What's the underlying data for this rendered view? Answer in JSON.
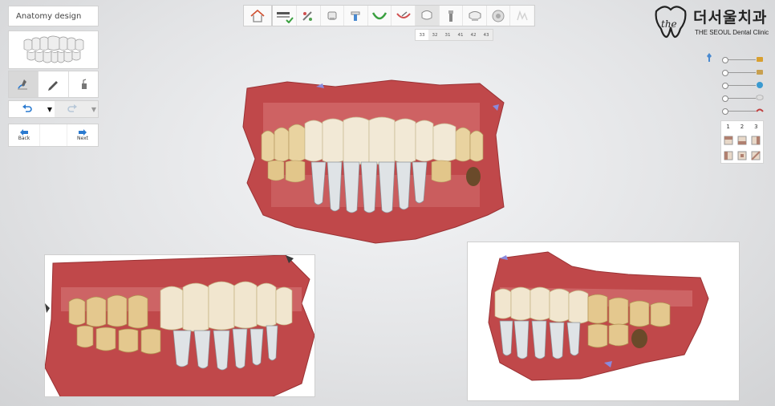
{
  "panel": {
    "title": "Anatomy design",
    "tools": [
      {
        "icon": "anatomy-tool-icon",
        "active": true
      },
      {
        "icon": "pencil-icon",
        "active": false
      },
      {
        "icon": "paint-tool-icon",
        "active": false
      }
    ],
    "nav": {
      "back_label": "Back",
      "next_label": "Next"
    }
  },
  "toolbar": {
    "steps": [
      {
        "icon": "home-icon"
      },
      {
        "icon": "scan-check-icon"
      },
      {
        "icon": "margin-icon"
      },
      {
        "icon": "model-icon"
      },
      {
        "icon": "implant-icon"
      },
      {
        "icon": "arch-icon"
      },
      {
        "icon": "cutback-icon"
      },
      {
        "icon": "tooth-icon",
        "active": true
      },
      {
        "icon": "connector-icon"
      },
      {
        "icon": "crown-icon"
      },
      {
        "icon": "mill-icon"
      },
      {
        "icon": "export-icon",
        "disabled": true
      }
    ],
    "tooth_tabs": [
      "33",
      "32",
      "31",
      "41",
      "42",
      "43"
    ]
  },
  "brand": {
    "korean_name": "더서울치과",
    "english_name": "THE SEOUL Dental Clinic"
  },
  "layers": [
    {
      "icon": "jaw-upper-icon",
      "color": "#d8a030"
    },
    {
      "icon": "jaw-lower-icon",
      "color": "#c8a050"
    },
    {
      "icon": "teeth-blue-icon",
      "color": "#3a9ad0"
    },
    {
      "icon": "tooth-white-icon",
      "color": "#c8c8c8"
    },
    {
      "icon": "gum-icon",
      "color": "#c04040"
    }
  ],
  "view_panel": {
    "numbers": [
      "1",
      "2",
      "3"
    ]
  }
}
